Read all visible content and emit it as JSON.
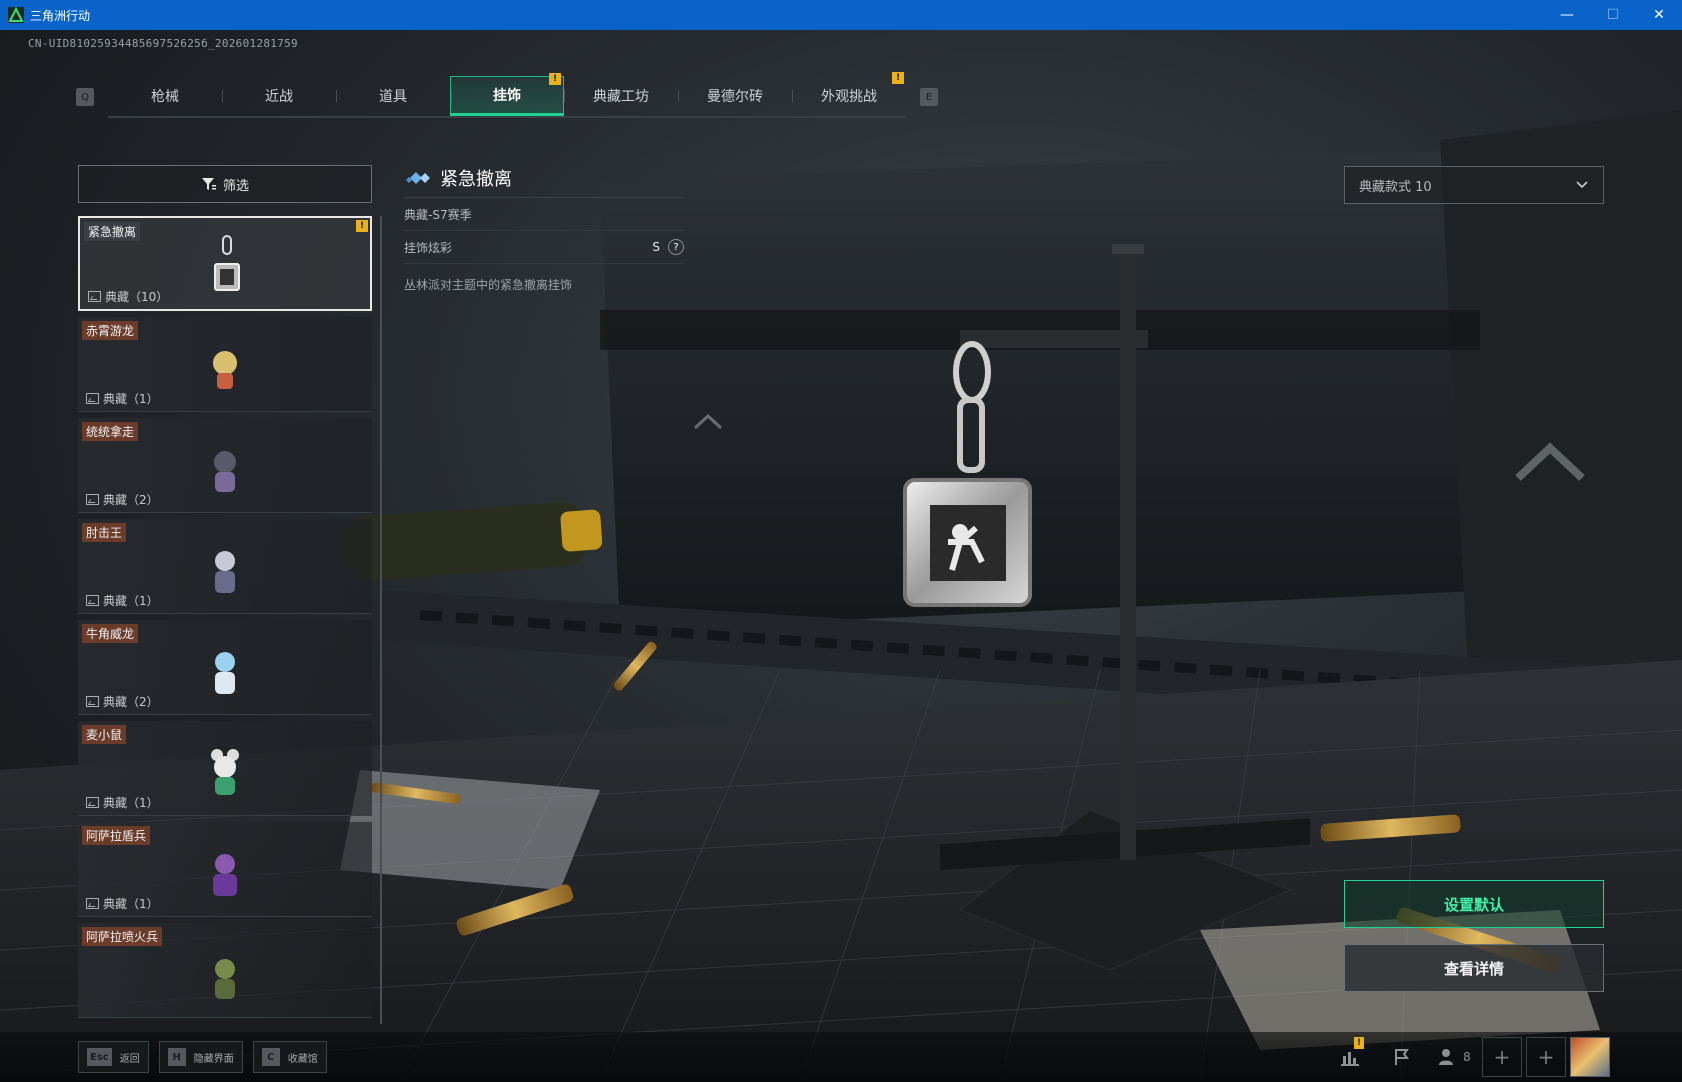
{
  "window": {
    "title": "三角洲行动",
    "controls": [
      "—",
      "☐",
      "✕"
    ]
  },
  "uid": "CN-UID8102593448569752625б_202601281759",
  "header": {
    "left_key": "Q",
    "right_key": "E",
    "tabs": [
      {
        "label": "枪械",
        "active": false,
        "alert": false
      },
      {
        "label": "近战",
        "active": false,
        "alert": false
      },
      {
        "label": "道具",
        "active": false,
        "alert": false
      },
      {
        "label": "挂饰",
        "active": true,
        "alert": true
      },
      {
        "label": "典藏工坊",
        "active": false,
        "alert": false
      },
      {
        "label": "曼德尔砖",
        "active": false,
        "alert": false
      },
      {
        "label": "外观挑战",
        "active": false,
        "alert": true
      }
    ],
    "alert_mark": "!"
  },
  "filter": {
    "label": "筛选"
  },
  "items": [
    {
      "name": "紧急撤离",
      "count": "典藏（10）",
      "selected": true,
      "alert": true
    },
    {
      "name": "赤霄游龙",
      "count": "典藏（1）",
      "selected": false,
      "alert": false
    },
    {
      "name": "统统拿走",
      "count": "典藏（2）",
      "selected": false,
      "alert": false
    },
    {
      "name": "肘击王",
      "count": "典藏（1）",
      "selected": false,
      "alert": false
    },
    {
      "name": "牛角威龙",
      "count": "典藏（2）",
      "selected": false,
      "alert": false
    },
    {
      "name": "麦小鼠",
      "count": "典藏（1）",
      "selected": false,
      "alert": false
    },
    {
      "name": "阿萨拉盾兵",
      "count": "典藏（1）",
      "selected": false,
      "alert": false
    },
    {
      "name": "阿萨拉喷火兵",
      "count": "",
      "selected": false,
      "alert": false
    }
  ],
  "detail": {
    "title": "紧急撤离",
    "season": "典藏-S7赛季",
    "flair_label": "挂饰炫彩",
    "flair_rank": "S",
    "help": "?",
    "description": "丛林派对主题中的紧急撤离挂饰"
  },
  "style_select": {
    "value": "典藏款式 10"
  },
  "actions": {
    "set_default": "设置默认",
    "view_detail": "查看详情"
  },
  "bottom": {
    "hints": [
      {
        "key": "Esc",
        "label": "返回"
      },
      {
        "key": "H",
        "label": "隐藏界面"
      },
      {
        "key": "C",
        "label": "收藏馆"
      }
    ],
    "friends_count": "8",
    "icons": [
      "stats-icon",
      "flag-icon",
      "friends-icon"
    ]
  },
  "colors": {
    "accent": "#1fcf94",
    "alert": "#e9b21a",
    "titlebar": "#0a63c9"
  }
}
